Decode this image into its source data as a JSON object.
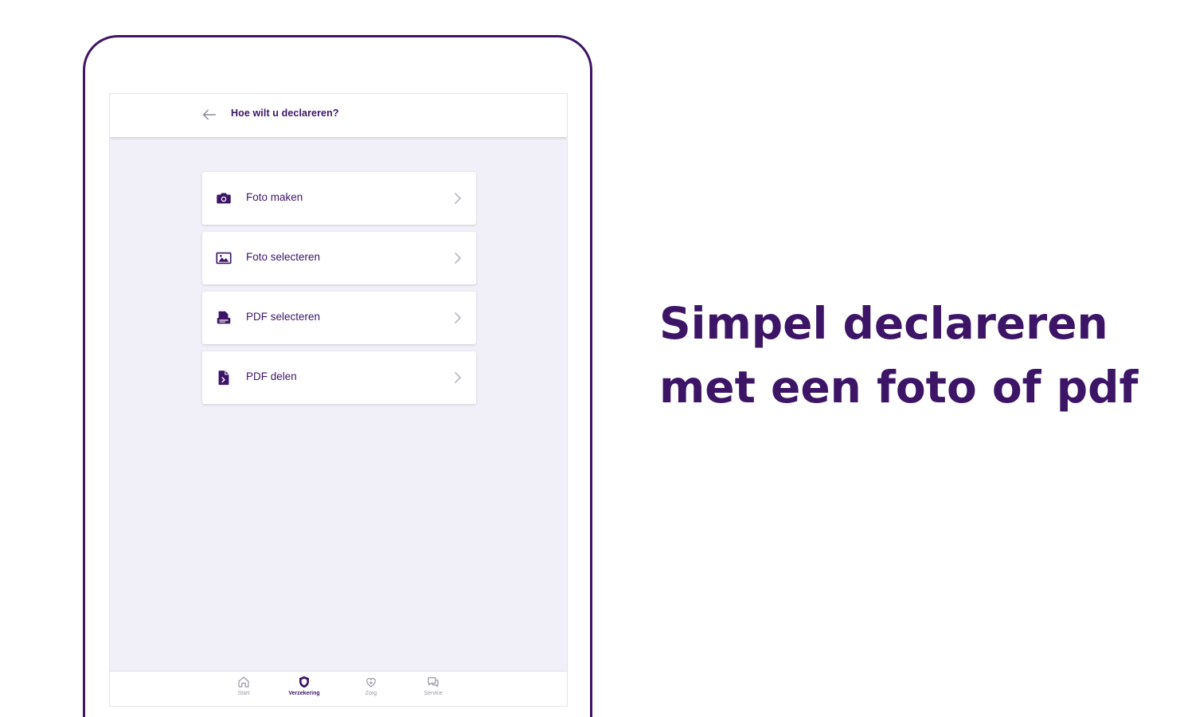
{
  "colors": {
    "brand": "#3d1566",
    "screen_background": "#f1eff8",
    "muted": "#9a97a6"
  },
  "appbar": {
    "back_icon": "arrow-left-icon",
    "title": "Hoe wilt u declareren?"
  },
  "options": [
    {
      "icon": "camera-icon",
      "label": "Foto maken"
    },
    {
      "icon": "image-icon",
      "label": "Foto selecteren"
    },
    {
      "icon": "pdf-folder-icon",
      "label": "PDF selecteren"
    },
    {
      "icon": "pdf-file-icon",
      "label": "PDF delen"
    }
  ],
  "bottom_nav": {
    "items": [
      {
        "icon": "home-icon",
        "label": "Start",
        "active": false
      },
      {
        "icon": "shield-icon",
        "label": "Verzekering",
        "active": true
      },
      {
        "icon": "care-icon",
        "label": "Zorg",
        "active": false
      },
      {
        "icon": "chat-icon",
        "label": "Service",
        "active": false
      }
    ]
  },
  "headline": {
    "line1": "Simpel declareren",
    "line2": "met een foto of pdf"
  }
}
